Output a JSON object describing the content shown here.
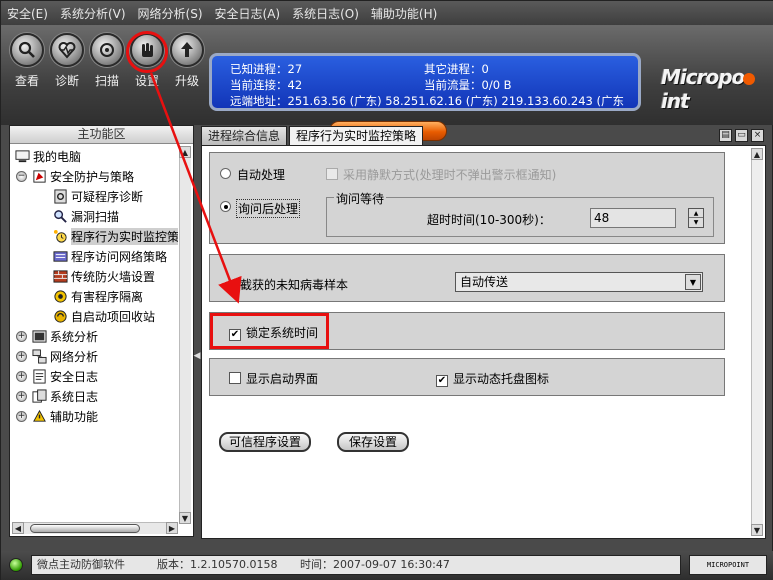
{
  "menu": {
    "items": [
      "安全(E)",
      "系统分析(V)",
      "网络分析(S)",
      "安全日志(A)",
      "系统日志(O)",
      "辅助功能(H)"
    ]
  },
  "toolbar": {
    "buttons": [
      {
        "label": "查看",
        "icon": "magnifier-icon"
      },
      {
        "label": "诊断",
        "icon": "heartbeat-icon"
      },
      {
        "label": "扫描",
        "icon": "scan-icon"
      },
      {
        "label": "设置",
        "icon": "hand-icon"
      },
      {
        "label": "升级",
        "icon": "upgrade-icon"
      }
    ]
  },
  "info_panel": {
    "known_processes": "已知进程：27",
    "other_processes": "其它进程：0",
    "current_connections": "当前连接：42",
    "current_traffic": "当前流量：0/0 B",
    "remote_address": "远端地址：251.63.56 (广东)   58.251.62.16 (广东)   219.133.60.243 (广东"
  },
  "logo": {
    "text_before": "Micropo",
    "text_after": "int"
  },
  "window_controls": [
    "▤",
    "▭",
    "×"
  ],
  "left_panel": {
    "header": "主功能区",
    "tree": [
      {
        "label": "我的电脑",
        "icon": "computer-icon",
        "level": 0
      },
      {
        "label": "安全防护与策略",
        "icon": "shield-flag-icon",
        "level": 1,
        "expander": "−"
      },
      {
        "label": "可疑程序诊断",
        "icon": "diagnose-icon",
        "level": 2
      },
      {
        "label": "漏洞扫描",
        "icon": "magnifier-icon",
        "level": 2
      },
      {
        "label": "程序行为实时监控策",
        "icon": "monitor-clock-icon",
        "level": 2,
        "selected": true
      },
      {
        "label": "程序访问网络策略",
        "icon": "network-policy-icon",
        "level": 2
      },
      {
        "label": "传统防火墙设置",
        "icon": "firewall-icon",
        "level": 2
      },
      {
        "label": "有害程序隔离",
        "icon": "isolation-icon",
        "level": 2
      },
      {
        "label": "自启动项回收站",
        "icon": "recycle-icon",
        "level": 2
      },
      {
        "label": "系统分析",
        "icon": "system-analysis-icon",
        "level": 1,
        "expander": "+"
      },
      {
        "label": "网络分析",
        "icon": "network-analysis-icon",
        "level": 1,
        "expander": "+"
      },
      {
        "label": "安全日志",
        "icon": "security-log-icon",
        "level": 1,
        "expander": "+"
      },
      {
        "label": "系统日志",
        "icon": "system-log-icon",
        "level": 1,
        "expander": "+"
      },
      {
        "label": "辅助功能",
        "icon": "tools-icon",
        "level": 1,
        "expander": "+"
      }
    ]
  },
  "tabs": [
    {
      "label": "进程综合信息",
      "active": false
    },
    {
      "label": "程序行为实时监控策略",
      "active": true
    }
  ],
  "settings": {
    "auto_handle_label": "自动处理",
    "silent_mode_label": "采用静默方式(处理时不弹出警示框通知)",
    "ask_then_handle_label": "询问后处理",
    "ask_wait_group_label": "询问等待",
    "timeout_label": "超时时间(10-300秒)：",
    "timeout_value": "48",
    "unknown_virus_label": "对截获的未知病毒样本",
    "unknown_virus_option": "自动传送",
    "lock_time_label": "锁定系统时间",
    "lock_time_checked": true,
    "show_splash_label": "显示启动界面",
    "show_splash_checked": false,
    "show_tray_label": "显示动态托盘图标",
    "show_tray_checked": true,
    "trusted_btn": "可信程序设置",
    "save_btn": "保存设置"
  },
  "status": {
    "app_name": "微点主动防御软件",
    "version": "版本：1.2.10570.0158",
    "time": "时间：2007-09-07 16:30:47",
    "brand": "MICROPOINT"
  },
  "colors": {
    "accent_red": "#e81010",
    "info_blue": "#1f49d0",
    "orange": "#e85c00"
  }
}
